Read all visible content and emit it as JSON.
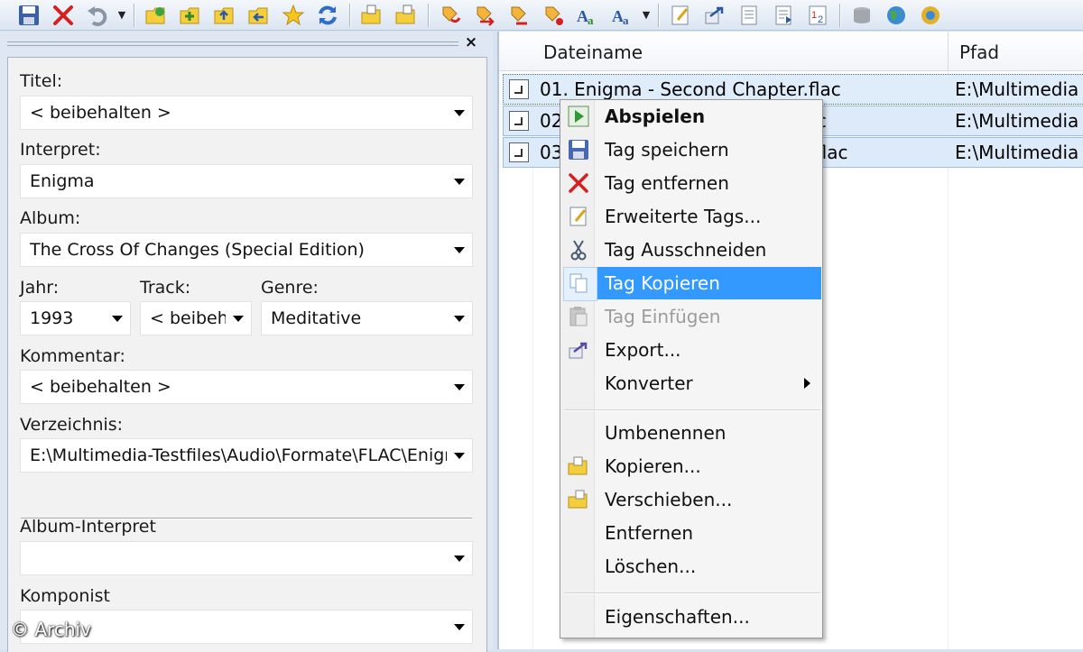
{
  "toolbar": {
    "buttons": [
      "save-icon",
      "delete-icon",
      "undo-icon",
      "open-folder-icon",
      "add-folder-icon",
      "folder-up-icon",
      "folder-back-icon",
      "favorite-star-icon",
      "refresh-icon",
      "copy-to-folder-icon",
      "move-to-folder-icon",
      "tag-from-filename-icon",
      "filename-from-tag-icon",
      "tag-from-tag-icon",
      "tag-from-list-icon",
      "case-conversion-icon",
      "text-replace-icon",
      "extended-tags-icon",
      "export-icon",
      "playlist-icon",
      "text-file-icon",
      "autonumber-icon",
      "database-icon",
      "web-sources-icon",
      "more-icon"
    ]
  },
  "panel": {
    "close": "×",
    "fields": {
      "title_label": "Titel:",
      "title_value": "< beibehalten >",
      "artist_label": "Interpret:",
      "artist_value": "Enigma",
      "album_label": "Album:",
      "album_value": "The Cross Of Changes (Special Edition)",
      "year_label": "Jahr:",
      "year_value": "1993",
      "track_label": "Track:",
      "track_value": "< beibeh",
      "genre_label": "Genre:",
      "genre_value": "Meditative",
      "comment_label": "Kommentar:",
      "comment_value": "< beibehalten >",
      "directory_label": "Verzeichnis:",
      "directory_value": "E:\\Multimedia-Testfiles\\Audio\\Formate\\FLAC\\Enigma",
      "album_artist_label": "Album-Interpret",
      "album_artist_value": "",
      "composer_label": "Komponist",
      "composer_value": ""
    }
  },
  "file_list": {
    "columns": [
      "Dateiname",
      "Pfad"
    ],
    "rows": [
      {
        "name": "01. Enigma - Second Chapter.flac",
        "path": "E:\\Multimedia"
      },
      {
        "name": "02",
        "name_tail": "flac",
        "path": "E:\\Multimedia"
      },
      {
        "name": "03",
        "name_tail": "ce.flac",
        "path": "E:\\Multimedia"
      }
    ]
  },
  "context_menu": {
    "items": [
      {
        "label": "Abspielen",
        "icon": "play-icon"
      },
      {
        "label": "Tag speichern",
        "icon": "save-icon"
      },
      {
        "label": "Tag entfernen",
        "icon": "remove-icon"
      },
      {
        "label": "Erweiterte Tags...",
        "icon": "extended-tags-icon"
      },
      {
        "label": "Tag Ausschneiden",
        "icon": "cut-icon"
      },
      {
        "label": "Tag Kopieren",
        "icon": "copy-icon"
      },
      {
        "label": "Tag Einfügen",
        "icon": "paste-icon"
      },
      {
        "label": "Export...",
        "icon": "export-icon"
      },
      {
        "label": "Konverter",
        "icon": ""
      },
      {
        "label": "Umbenennen",
        "icon": ""
      },
      {
        "label": "Kopieren...",
        "icon": "copy-folder-icon"
      },
      {
        "label": "Verschieben...",
        "icon": "move-folder-icon"
      },
      {
        "label": "Entfernen",
        "icon": ""
      },
      {
        "label": "Löschen...",
        "icon": ""
      },
      {
        "label": "Eigenschaften...",
        "icon": ""
      }
    ]
  },
  "watermark": "© Archiv",
  "colors": {
    "menu_highlight": "#3399ff",
    "selected_row": "#dceaf9",
    "toolbar_bg": "#dbe5f1"
  }
}
